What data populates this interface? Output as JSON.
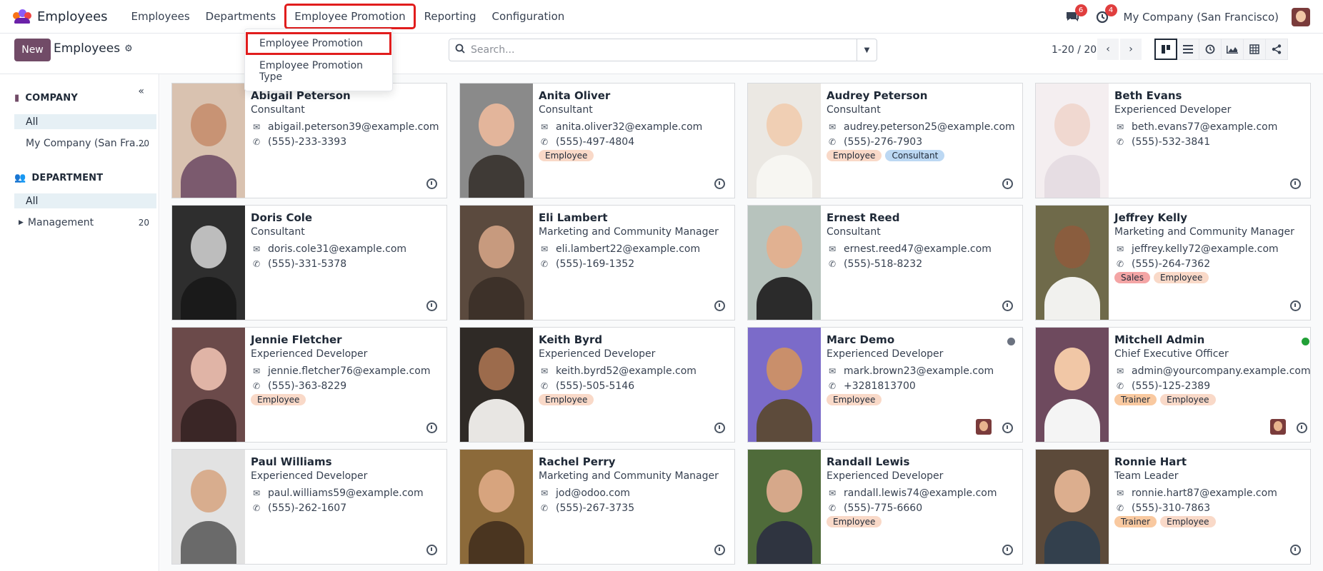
{
  "app": {
    "title": "Employees"
  },
  "nav": {
    "items": [
      "Employees",
      "Departments",
      "Employee Promotion",
      "Reporting",
      "Configuration"
    ],
    "highlighted_index": 2,
    "messages_count": "6",
    "activities_count": "4",
    "company": "My Company (San Francisco)"
  },
  "dropdown": {
    "items": [
      "Employee Promotion",
      "Employee Promotion Type"
    ]
  },
  "control": {
    "new_label": "New",
    "breadcrumb": "Employees",
    "search_placeholder": "Search...",
    "pager": "1-20 / 20"
  },
  "icons": {
    "brand": "employees-app-icon",
    "messages": "chat-icon",
    "activities": "clock-icon",
    "settings": "gear-icon",
    "search": "search-icon",
    "email": "envelope-icon",
    "phone": "phone-icon"
  },
  "sidebar": {
    "company_title": "COMPANY",
    "company_items": [
      {
        "label": "All",
        "count": "",
        "active": true
      },
      {
        "label": "My Company (San Fra…",
        "count": "20",
        "active": false
      }
    ],
    "department_title": "DEPARTMENT",
    "department_items": [
      {
        "label": "All",
        "count": "",
        "active": true
      },
      {
        "label": "Management",
        "count": "20",
        "active": false
      }
    ]
  },
  "colors": {
    "primary": "#714b67",
    "highlight": "#e11d1d",
    "tag_employee": "#f9d9c8",
    "tag_consultant": "#bcd8f3",
    "tag_sales": "#f4a5a5",
    "tag_trainer": "#f9c9a0",
    "status_online": "#21a037",
    "status_away": "#6b7280"
  },
  "employees": [
    {
      "name": "Abigail Peterson",
      "job": "Consultant",
      "email": "abigail.peterson39@example.com",
      "phone": "(555)-233-3393",
      "tags": [],
      "status": "",
      "avatar": false,
      "photo": {
        "bg": "#d9c2b0",
        "head": "#c89374",
        "torso": "#7b5a6e"
      }
    },
    {
      "name": "Anita Oliver",
      "job": "Consultant",
      "email": "anita.oliver32@example.com",
      "phone": "(555)-497-4804",
      "tags": [
        "Employee"
      ],
      "status": "",
      "avatar": false,
      "photo": {
        "bg": "#8a8a8a",
        "head": "#e3b59b",
        "torso": "#3f3a36"
      }
    },
    {
      "name": "Audrey Peterson",
      "job": "Consultant",
      "email": "audrey.peterson25@example.com",
      "phone": "(555)-276-7903",
      "tags": [
        "Employee",
        "Consultant"
      ],
      "status": "",
      "avatar": false,
      "photo": {
        "bg": "#ebe8e3",
        "head": "#f0cfb4",
        "torso": "#f7f6f2"
      }
    },
    {
      "name": "Beth Evans",
      "job": "Experienced Developer",
      "email": "beth.evans77@example.com",
      "phone": "(555)-532-3841",
      "tags": [],
      "status": "",
      "avatar": false,
      "photo": {
        "bg": "#f4eef0",
        "head": "#f0d8d0",
        "torso": "#e6dde3"
      }
    },
    {
      "name": "Doris Cole",
      "job": "Consultant",
      "email": "doris.cole31@example.com",
      "phone": "(555)-331-5378",
      "tags": [],
      "status": "",
      "avatar": false,
      "photo": {
        "bg": "#2e2e2e",
        "head": "#bdbdbd",
        "torso": "#1a1a1a"
      }
    },
    {
      "name": "Eli Lambert",
      "job": "Marketing and Community Manager",
      "email": "eli.lambert22@example.com",
      "phone": "(555)-169-1352",
      "tags": [],
      "status": "",
      "avatar": false,
      "photo": {
        "bg": "#5b4a3e",
        "head": "#c79a7e",
        "torso": "#3d3129"
      }
    },
    {
      "name": "Ernest Reed",
      "job": "Consultant",
      "email": "ernest.reed47@example.com",
      "phone": "(555)-518-8232",
      "tags": [],
      "status": "",
      "avatar": false,
      "photo": {
        "bg": "#b7c3bd",
        "head": "#e1b191",
        "torso": "#2b2b2b"
      }
    },
    {
      "name": "Jeffrey Kelly",
      "job": "Marketing and Community Manager",
      "email": "jeffrey.kelly72@example.com",
      "phone": "(555)-264-7362",
      "tags": [
        "Sales",
        "Employee"
      ],
      "status": "",
      "avatar": false,
      "photo": {
        "bg": "#6f6a4a",
        "head": "#8a5d3e",
        "torso": "#f1f1ee"
      }
    },
    {
      "name": "Jennie Fletcher",
      "job": "Experienced Developer",
      "email": "jennie.fletcher76@example.com",
      "phone": "(555)-363-8229",
      "tags": [
        "Employee"
      ],
      "status": "",
      "avatar": false,
      "photo": {
        "bg": "#6b4a4a",
        "head": "#e0b4a6",
        "torso": "#3a2626"
      }
    },
    {
      "name": "Keith Byrd",
      "job": "Experienced Developer",
      "email": "keith.byrd52@example.com",
      "phone": "(555)-505-5146",
      "tags": [
        "Employee"
      ],
      "status": "",
      "avatar": false,
      "photo": {
        "bg": "#2f2a26",
        "head": "#9c6b4c",
        "torso": "#e8e6e3"
      }
    },
    {
      "name": "Marc Demo",
      "job": "Experienced Developer",
      "email": "mark.brown23@example.com",
      "phone": "+3281813700",
      "tags": [
        "Employee"
      ],
      "status": "away",
      "avatar": true,
      "photo": {
        "bg": "#7b6bc9",
        "head": "#c98f6b",
        "torso": "#5d4b3b"
      }
    },
    {
      "name": "Mitchell Admin",
      "job": "Chief Executive Officer",
      "email": "admin@yourcompany.example.com",
      "phone": "(555)-125-2389",
      "tags": [
        "Trainer",
        "Employee"
      ],
      "status": "online",
      "avatar": true,
      "photo": {
        "bg": "#6e4a5e",
        "head": "#f1c7a6",
        "torso": "#f4f4f4"
      }
    },
    {
      "name": "Paul Williams",
      "job": "Experienced Developer",
      "email": "paul.williams59@example.com",
      "phone": "(555)-262-1607",
      "tags": [],
      "status": "",
      "avatar": false,
      "photo": {
        "bg": "#e2e2e2",
        "head": "#d8ad8e",
        "torso": "#6a6a6a"
      }
    },
    {
      "name": "Rachel Perry",
      "job": "Marketing and Community Manager",
      "email": "jod@odoo.com",
      "phone": "(555)-267-3735",
      "tags": [],
      "status": "",
      "avatar": false,
      "photo": {
        "bg": "#8c6a3a",
        "head": "#d7a47e",
        "torso": "#4a3520"
      }
    },
    {
      "name": "Randall Lewis",
      "job": "Experienced Developer",
      "email": "randall.lewis74@example.com",
      "phone": "(555)-775-6660",
      "tags": [
        "Employee"
      ],
      "status": "",
      "avatar": false,
      "photo": {
        "bg": "#4f6b3a",
        "head": "#d6a88a",
        "torso": "#2f3440"
      }
    },
    {
      "name": "Ronnie Hart",
      "job": "Team Leader",
      "email": "ronnie.hart87@example.com",
      "phone": "(555)-310-7863",
      "tags": [
        "Trainer",
        "Employee"
      ],
      "status": "",
      "avatar": false,
      "photo": {
        "bg": "#5c4a3a",
        "head": "#dcae8e",
        "torso": "#33404d"
      }
    }
  ]
}
